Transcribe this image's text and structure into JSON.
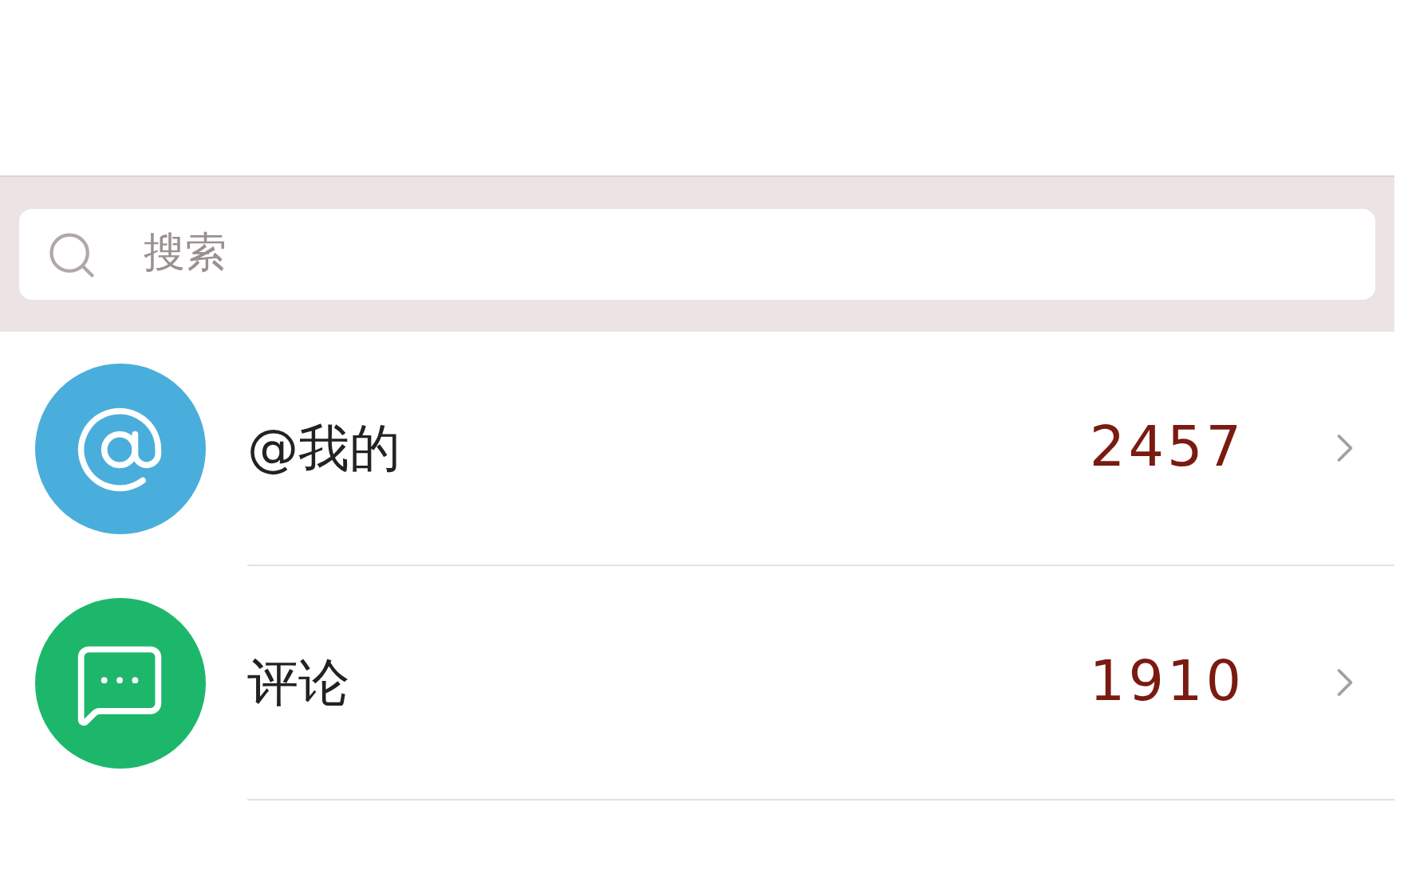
{
  "search": {
    "placeholder": "搜索"
  },
  "items": [
    {
      "kind": "mention",
      "label": "@我的",
      "count": "2457"
    },
    {
      "kind": "comment",
      "label": "评论",
      "count": "1910"
    }
  ]
}
